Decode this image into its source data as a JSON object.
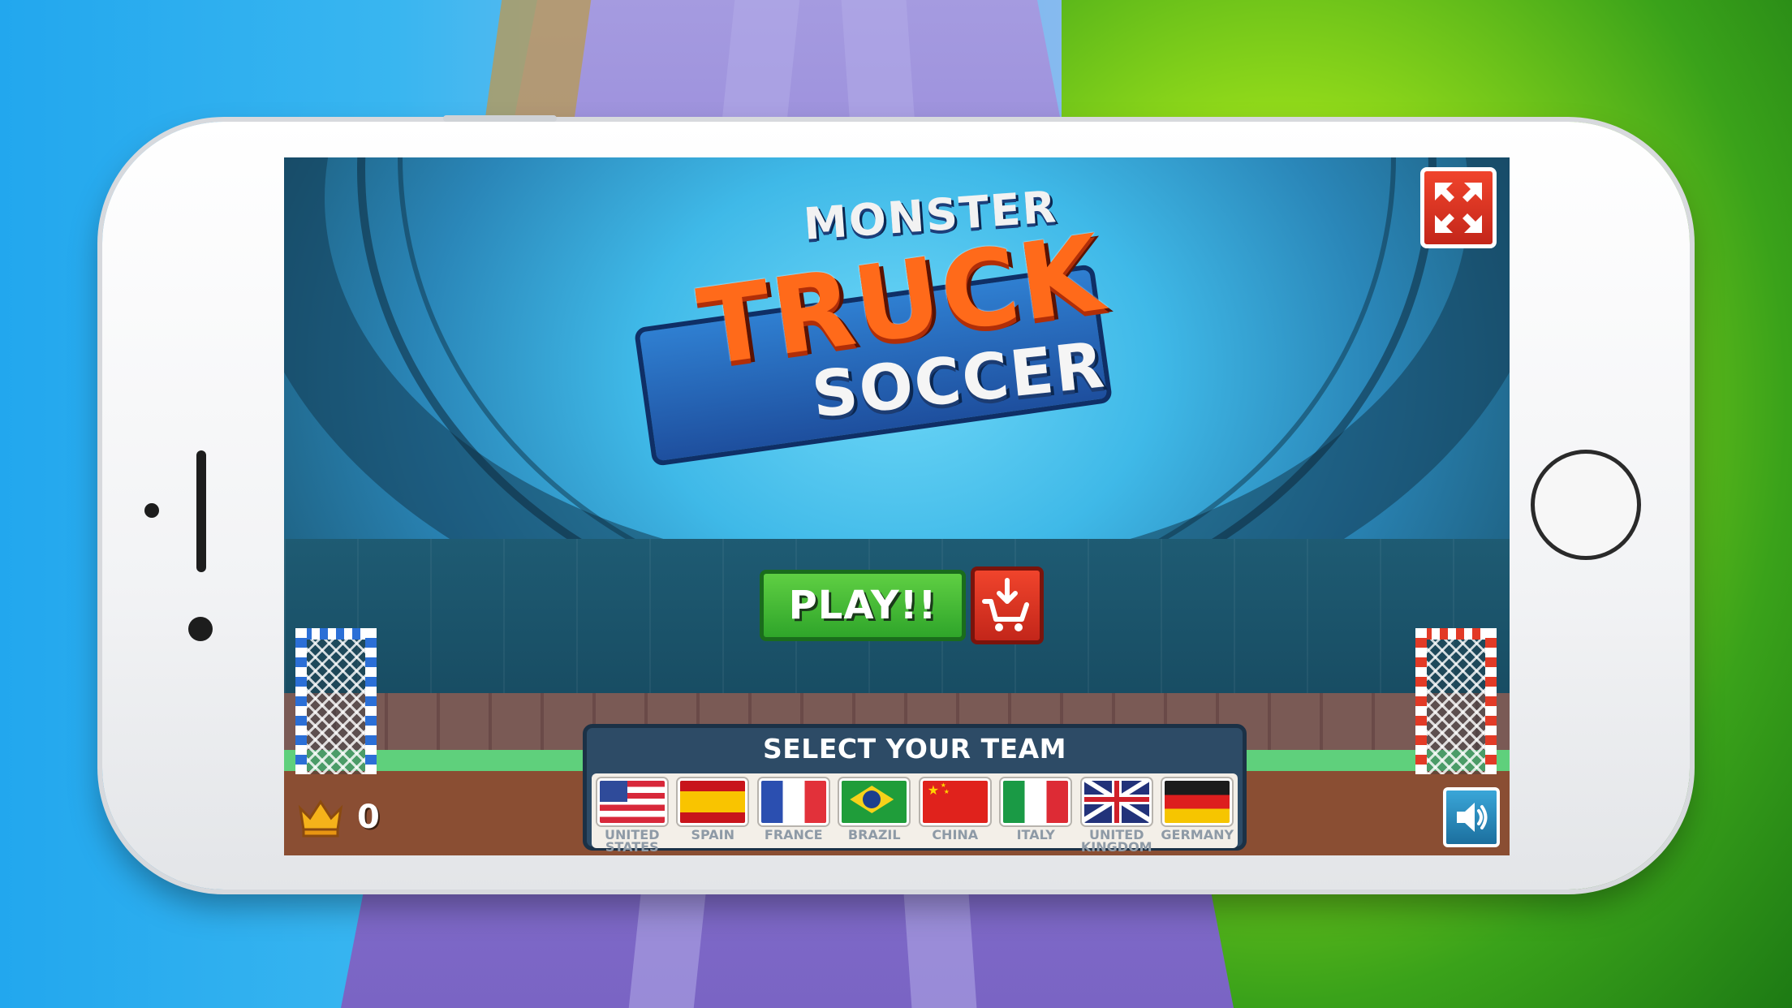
{
  "game": {
    "logo": {
      "monster": "MONSTER",
      "truck": "TRUCK",
      "soccer": "SOCCER"
    },
    "play_label": "PLAY!!",
    "shop_icon": "cart-download-icon",
    "fullscreen_icon": "fullscreen-icon",
    "sound_icon": "speaker-icon",
    "score": "0",
    "crown_icon": "crown-icon",
    "team_select": {
      "title": "SELECT YOUR TEAM",
      "teams": [
        {
          "name": "UNITED STATES",
          "flag": "us-flag"
        },
        {
          "name": "SPAIN",
          "flag": "spain-flag"
        },
        {
          "name": "FRANCE",
          "flag": "france-flag"
        },
        {
          "name": "BRAZIL",
          "flag": "brazil-flag"
        },
        {
          "name": "CHINA",
          "flag": "china-flag"
        },
        {
          "name": "ITALY",
          "flag": "italy-flag"
        },
        {
          "name": "UNITED KINGDOM",
          "flag": "uk-flag"
        },
        {
          "name": "GERMANY",
          "flag": "germany-flag"
        }
      ]
    }
  },
  "colors": {
    "play_green": "#3fb832",
    "action_red": "#e23a26",
    "panel_navy": "#2d4b66",
    "sound_blue": "#2a8cc0"
  }
}
